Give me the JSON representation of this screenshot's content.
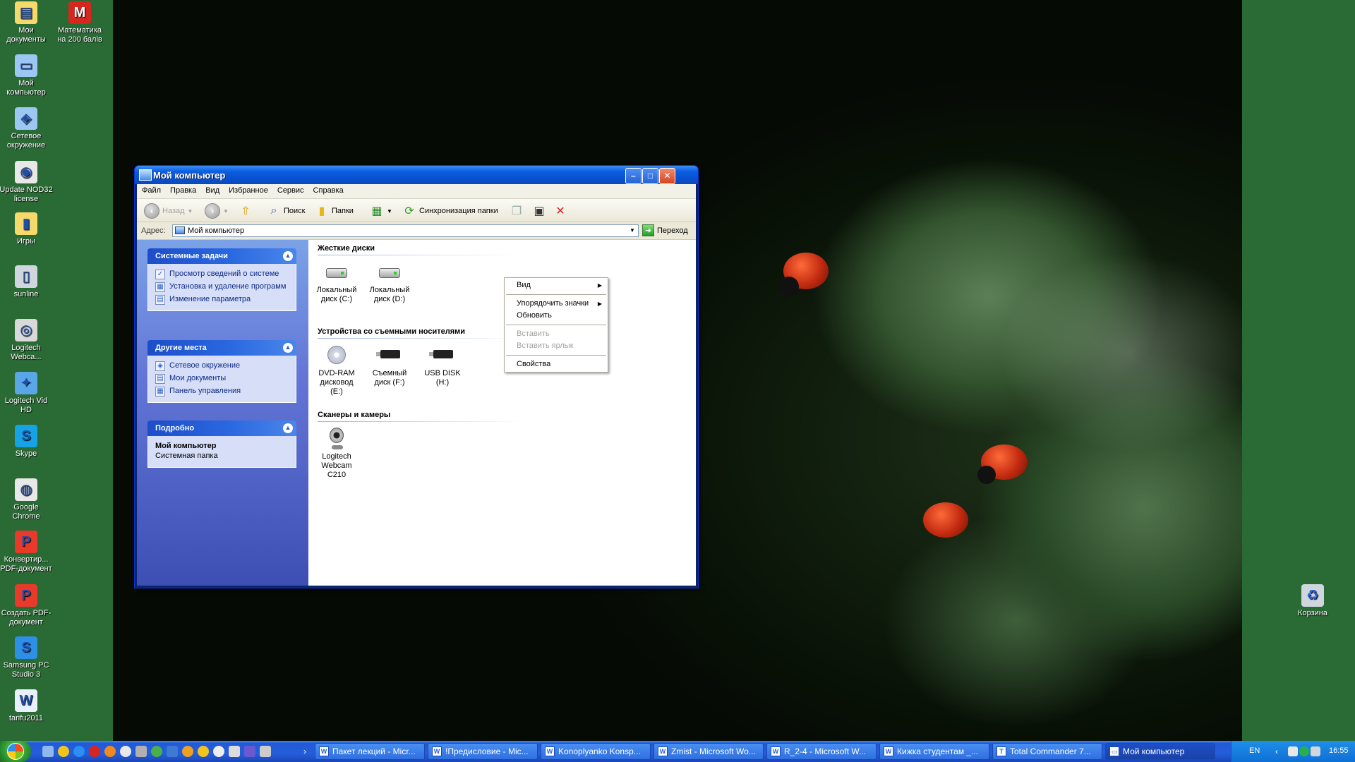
{
  "desktop": {
    "icons_left": [
      {
        "label": "Мои документы",
        "icon": "my-documents-icon",
        "color": "#f6d96b",
        "glyph": "▤"
      },
      {
        "label": "Мой компьютер",
        "icon": "my-computer-icon",
        "color": "#9cc7f3",
        "glyph": "▭"
      },
      {
        "label": "Сетевое окружение",
        "icon": "network-icon",
        "color": "#9cc7f3",
        "glyph": "◈"
      },
      {
        "label": "Update NOD32 license",
        "icon": "nod32-icon",
        "color": "#e8e8e8",
        "glyph": "◉"
      },
      {
        "label": "Игры",
        "icon": "folder-icon",
        "color": "#f6d96b",
        "glyph": "▮"
      },
      {
        "label": "sunline",
        "icon": "sunline-icon",
        "color": "#cfd6de",
        "glyph": "▯"
      },
      {
        "label": "Logitech Webca...",
        "icon": "webcam-icon",
        "color": "#d9d9d9",
        "glyph": "◎"
      },
      {
        "label": "Logitech Vid HD",
        "icon": "logitech-vid-icon",
        "color": "#5aa7e8",
        "glyph": "✦"
      },
      {
        "label": "Skype",
        "icon": "skype-icon",
        "color": "#15a3e6",
        "glyph": "S"
      },
      {
        "label": "Google Chrome",
        "icon": "chrome-icon",
        "color": "#e8e8e8",
        "glyph": "◍"
      },
      {
        "label": "Конвертир... PDF-документ",
        "icon": "pdf-convert-icon",
        "color": "#e83a2a",
        "glyph": "P"
      },
      {
        "label": "Создать PDF-документ",
        "icon": "pdf-create-icon",
        "color": "#e83a2a",
        "glyph": "P"
      },
      {
        "label": "Samsung PC Studio 3",
        "icon": "samsung-pc-studio-icon",
        "color": "#2d8fe6",
        "glyph": "S"
      },
      {
        "label": "tarifu2011",
        "icon": "word-document-icon",
        "color": "#e9f0fb",
        "glyph": "W"
      }
    ],
    "icon_math": {
      "label": "Математика на 200 балів",
      "icon": "math-app-icon",
      "color": "#d7261e",
      "glyph": "M"
    },
    "icon_recycle": {
      "label": "Корзина",
      "icon": "recycle-bin-icon",
      "color": "#cfd6de",
      "glyph": "♻"
    }
  },
  "window": {
    "title": "Мой компьютер",
    "menu": [
      "Файл",
      "Правка",
      "Вид",
      "Избранное",
      "Сервис",
      "Справка"
    ],
    "toolbar": {
      "back": "Назад",
      "search": "Поиск",
      "folders": "Папки",
      "sync": "Синхронизация папки"
    },
    "address": {
      "label": "Адрес:",
      "value": "Мой компьютер",
      "go": "Переход"
    },
    "panels": {
      "system_tasks": {
        "title": "Системные задачи",
        "items": [
          "Просмотр сведений о системе",
          "Установка и удаление программ",
          "Изменение параметра"
        ]
      },
      "other_places": {
        "title": "Другие места",
        "items": [
          "Сетевое окружение",
          "Мои документы",
          "Панель управления"
        ]
      },
      "details": {
        "title": "Подробно",
        "name": "Мой компьютер",
        "desc": "Системная папка"
      }
    },
    "groups": {
      "hard_drives": {
        "title": "Жесткие диски",
        "items": [
          "Локальный диск (C:)",
          "Локальный диск (D:)"
        ]
      },
      "removable": {
        "title": "Устройства со съемными носителями",
        "items": [
          "DVD-RAM дисковод (E:)",
          "Съемный диск (F:)",
          "USB DISK (H:)"
        ]
      },
      "scanners": {
        "title": "Сканеры и камеры",
        "items": [
          "Logitech Webcam C210"
        ]
      }
    }
  },
  "context_menu": {
    "view": "Вид",
    "arrange": "Упорядочить значки",
    "refresh": "Обновить",
    "paste": "Вставить",
    "paste_shortcut": "Вставить ярлык",
    "properties": "Свойства"
  },
  "taskbar": {
    "tasks": [
      "Пакет лекций - Micr...",
      "!Предисловие - Mic...",
      "Konoplyanko Konsp...",
      "Zmist - Microsoft Wo...",
      "R_2-4 - Microsoft W...",
      "Кижка студентам _...",
      "Total Commander 7...",
      "Мой компьютер"
    ],
    "lang": "EN",
    "clock": "16:55"
  }
}
